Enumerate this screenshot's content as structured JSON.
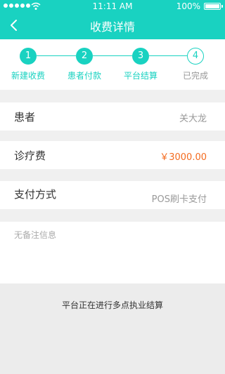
{
  "status_bar": {
    "time": "11:11 AM",
    "battery": "100%"
  },
  "header": {
    "title": "收费详情"
  },
  "steps": [
    {
      "number": "1",
      "label": "新建收费"
    },
    {
      "number": "2",
      "label": "患者付款"
    },
    {
      "number": "3",
      "label": "平台结算"
    },
    {
      "number": "4",
      "label": "已完成"
    }
  ],
  "details": {
    "patient_label": "患者",
    "patient_value": "关大龙",
    "fee_label": "诊疗费",
    "fee_value": "￥3000.00",
    "payment_label": "支付方式",
    "payment_value": "POS刷卡支付"
  },
  "memo": {
    "placeholder": "无备注信息"
  },
  "notice": {
    "text": "平台正在进行多点执业结算"
  },
  "colors": {
    "accent": "#19d2c1",
    "amount": "#f46b1f"
  }
}
